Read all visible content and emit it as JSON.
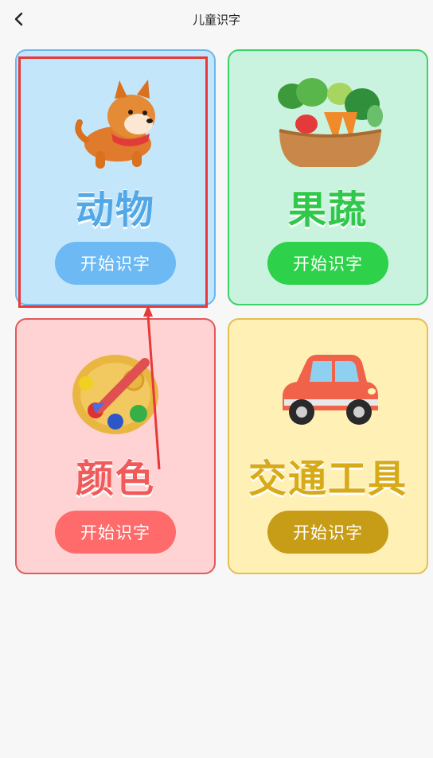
{
  "header": {
    "title": "儿童识字",
    "back_icon": "chevron-left-icon"
  },
  "categories": [
    {
      "id": "animals",
      "label": "动物",
      "button": "开始识字",
      "icon": "dog-icon",
      "label_color": "#52a8e6",
      "button_color": "#6cb9f4",
      "bg": "#c3e6fb"
    },
    {
      "id": "veg",
      "label": "果蔬",
      "button": "开始识字",
      "icon": "vegetable-basket-icon",
      "label_color": "#2fc84b",
      "button_color": "#2ed14a",
      "bg": "#c9f3de"
    },
    {
      "id": "colors",
      "label": "颜色",
      "button": "开始识字",
      "icon": "paint-palette-icon",
      "label_color": "#f05a5a",
      "button_color": "#ff6a6a",
      "bg": "#ffd3d3"
    },
    {
      "id": "vehicle",
      "label": "交通工具",
      "button": "开始识字",
      "icon": "car-icon",
      "label_color": "#d7aa18",
      "button_color": "#c79d17",
      "bg": "#fff0b6"
    }
  ],
  "annotation": {
    "highlight_color": "#e83838"
  }
}
